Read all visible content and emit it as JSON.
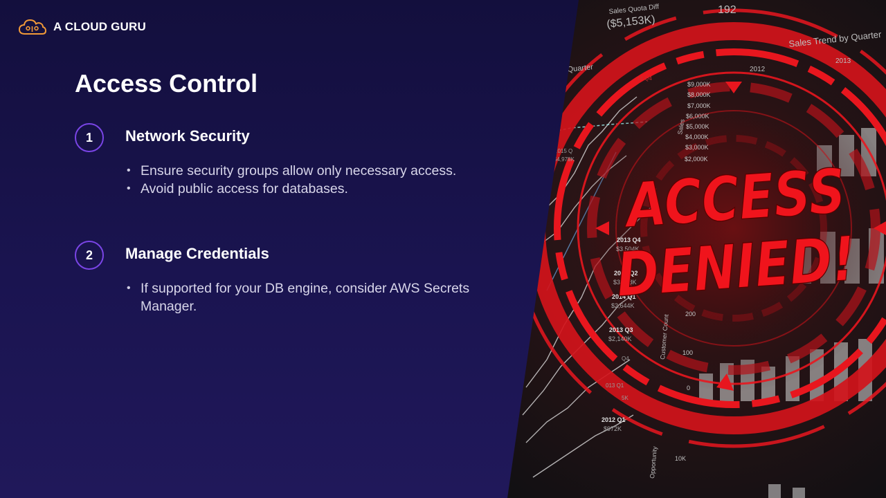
{
  "brand": {
    "name": "A CLOUD GURU",
    "icon": "cloud-logo-icon",
    "accent": "#f29a38"
  },
  "slide": {
    "title": "Access Control",
    "sections": [
      {
        "number": "1",
        "heading": "Network Security",
        "bullets": [
          "Ensure security groups allow only necessary access.",
          "Avoid public access for databases."
        ]
      },
      {
        "number": "2",
        "heading": "Manage Credentials",
        "bullets": [
          "If supported for your DB engine, consider AWS Secrets Manager."
        ]
      }
    ]
  },
  "image": {
    "headline_line1": "ACCESS",
    "headline_line2": "DENIED!",
    "top_value": "192",
    "sales_quota_label": "Sales Quota Diff",
    "sales_quota_value": "($5,153K)",
    "sales_trend_label": "Sales Trend by Quarter",
    "quarter_label": "Quarter",
    "year_2012": "2012",
    "year_2013": "2013",
    "sales_axis_label": "Sales",
    "sales_ticks": [
      "$9,000K",
      "$8,000K",
      "$7,000K",
      "$6,000K",
      "$5,000K",
      "$4,000K",
      "$3,000K",
      "$2,000K"
    ],
    "customer_axis_label": "Customer Count",
    "customer_ticks": [
      "200",
      "100",
      "0"
    ],
    "opportunity_label": "Opportunity",
    "bottom_tick": "10K",
    "quarters": [
      {
        "q": "2013 Q4",
        "v": "$3,504K"
      },
      {
        "q": "2014 Q2",
        "v": "$3,358K"
      },
      {
        "q": "2014 Q1",
        "v": "$2,644K"
      },
      {
        "q": "2013 Q3",
        "v": "$2,140K"
      },
      {
        "q": "2012 Q1",
        "v": "$972K"
      }
    ],
    "fragments": [
      "2015 Q",
      "$4,978K",
      "Q4",
      "013 Q1",
      "5K",
      "14 Q4"
    ],
    "warning_color": "#e8161e"
  }
}
